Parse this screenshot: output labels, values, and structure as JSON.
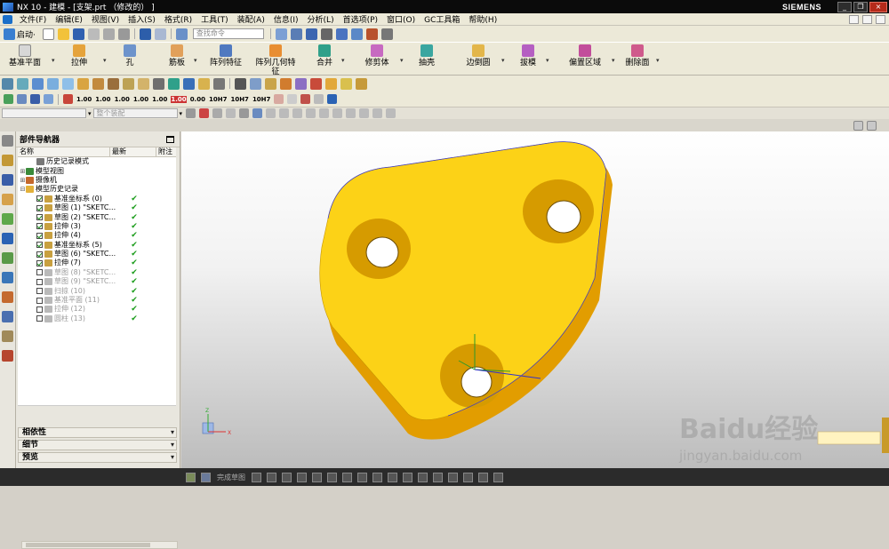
{
  "window": {
    "title": "NX 10 - 建模 - [支架.prt （修改的） ]",
    "brand": "SIEMENS",
    "controls": [
      "_",
      "❐",
      "×"
    ]
  },
  "menubar": [
    "文件(F)",
    "编辑(E)",
    "视图(V)",
    "插入(S)",
    "格式(R)",
    "工具(T)",
    "装配(A)",
    "信息(I)",
    "分析(L)",
    "首选项(P)",
    "窗口(O)",
    "GC工具箱",
    "帮助(H)"
  ],
  "toolbar": {
    "start_label": "启动·",
    "search_placeholder": "查找命令"
  },
  "ribbon": {
    "buttons": [
      "基准平面",
      "拉伸",
      "孔",
      "筋板",
      "阵列特征",
      "阵列几何特征",
      "合并",
      "修剪体",
      "抽壳",
      "边倒圆",
      "拔模",
      "偏置区域",
      "删除面"
    ]
  },
  "dimension_toolbar": [
    "1.00",
    "1.00",
    "1.00",
    "1.00",
    "1.00",
    "1.00",
    "0.00",
    "10H7",
    "10H7",
    "10H7"
  ],
  "selection_bar": {
    "filter_value": "",
    "scope_value": "整个装配"
  },
  "navigator": {
    "title": "部件导航器",
    "columns": [
      "名称",
      "最新",
      "附注"
    ],
    "tree": [
      {
        "label": "历史记录模式",
        "level": 1,
        "state": "mode",
        "latest": false,
        "dim": false
      },
      {
        "label": "模型视图",
        "level": 0,
        "state": "group",
        "latest": false,
        "dim": false
      },
      {
        "label": "摄像机",
        "level": 0,
        "state": "group-checked",
        "latest": false,
        "dim": false
      },
      {
        "label": "模型历史记录",
        "level": 0,
        "state": "folder",
        "latest": false,
        "dim": false
      },
      {
        "label": "基准坐标系 (0)",
        "level": 1,
        "state": "on",
        "latest": true,
        "dim": false
      },
      {
        "label": "草图 (1) \"SKETC...",
        "level": 1,
        "state": "on",
        "latest": true,
        "dim": false
      },
      {
        "label": "草图 (2) \"SKETC...",
        "level": 1,
        "state": "on",
        "latest": true,
        "dim": false
      },
      {
        "label": "拉伸 (3)",
        "level": 1,
        "state": "on",
        "latest": true,
        "dim": false
      },
      {
        "label": "拉伸 (4)",
        "level": 1,
        "state": "on",
        "latest": true,
        "dim": false
      },
      {
        "label": "基准坐标系 (5)",
        "level": 1,
        "state": "on",
        "latest": true,
        "dim": false
      },
      {
        "label": "草图 (6) \"SKETC...",
        "level": 1,
        "state": "on",
        "latest": true,
        "dim": false
      },
      {
        "label": "拉伸 (7)",
        "level": 1,
        "state": "on",
        "latest": true,
        "dim": false
      },
      {
        "label": "草图 (8) \"SKETC...",
        "level": 1,
        "state": "off",
        "latest": true,
        "dim": true
      },
      {
        "label": "草图 (9) \"SKETC...",
        "level": 1,
        "state": "off",
        "latest": true,
        "dim": true
      },
      {
        "label": "扫掠 (10)",
        "level": 1,
        "state": "off",
        "latest": true,
        "dim": true
      },
      {
        "label": "基准平面 (11)",
        "level": 1,
        "state": "off",
        "latest": true,
        "dim": true
      },
      {
        "label": "拉伸 (12)",
        "level": 1,
        "state": "off",
        "latest": true,
        "dim": true
      },
      {
        "label": "圆柱 (13)",
        "level": 1,
        "state": "off",
        "latest": true,
        "dim": true
      }
    ],
    "sections": [
      "相依性",
      "细节",
      "预览"
    ]
  },
  "bottom_toolbar": {
    "finish_sketch": "完成草图"
  },
  "watermark": {
    "brand": "Baidu经验",
    "url": "jingyan.baidu.com"
  },
  "axes": {
    "x": "X",
    "y": "Y",
    "z": "Z"
  },
  "colors": {
    "part_face": "#fcd217",
    "part_side": "#e8a800",
    "checkmark": "#1a9c1a",
    "title_bg": "#0b0b0b"
  }
}
